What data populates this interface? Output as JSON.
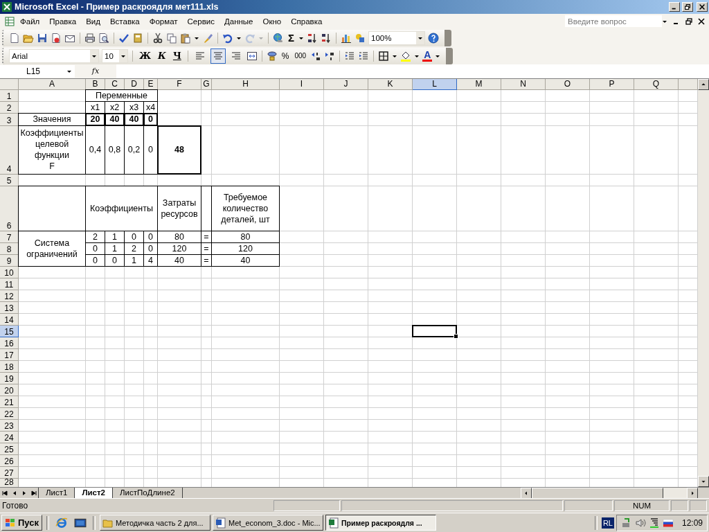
{
  "window": {
    "title": "Microsoft Excel - Пример раскроядля мет111.xls"
  },
  "menu": [
    {
      "label": "Файл"
    },
    {
      "label": "Правка"
    },
    {
      "label": "Вид"
    },
    {
      "label": "Вставка"
    },
    {
      "label": "Формат"
    },
    {
      "label": "Сервис"
    },
    {
      "label": "Данные"
    },
    {
      "label": "Окно"
    },
    {
      "label": "Справка"
    }
  ],
  "help_search": {
    "placeholder": "Введите вопрос"
  },
  "standard_toolbar": {
    "redo_disabled": true,
    "autosum": "Σ",
    "zoom": "100%"
  },
  "formatting_toolbar": {
    "font": "Arial",
    "size": "10",
    "style_buttons": [
      "Ж",
      "К",
      "Ч"
    ],
    "align_buttons": [
      {
        "selected": false
      },
      {
        "selected": true
      },
      {
        "selected": false
      }
    ],
    "percent": "%",
    "thousands": "000",
    "font_color": "A"
  },
  "formula_bar": {
    "name_box": "L15",
    "function_label": "fx"
  },
  "sheet": {
    "columns": [
      {
        "label": "A",
        "selected": false
      },
      {
        "label": "B",
        "selected": false
      },
      {
        "label": "C",
        "selected": false
      },
      {
        "label": "D",
        "selected": false
      },
      {
        "label": "E",
        "selected": false
      },
      {
        "label": "F",
        "selected": false
      },
      {
        "label": "G",
        "selected": false
      },
      {
        "label": "H",
        "selected": false
      },
      {
        "label": "I",
        "selected": false
      },
      {
        "label": "J",
        "selected": false
      },
      {
        "label": "K",
        "selected": false
      },
      {
        "label": "L",
        "selected": true
      },
      {
        "label": "M",
        "selected": false
      },
      {
        "label": "N",
        "selected": false
      },
      {
        "label": "O",
        "selected": false
      },
      {
        "label": "P",
        "selected": false
      },
      {
        "label": "Q",
        "selected": false
      }
    ],
    "rows": [
      {
        "label": "1",
        "selected": false
      },
      {
        "label": "2",
        "selected": false
      },
      {
        "label": "3",
        "selected": false
      },
      {
        "label": "4",
        "selected": false
      },
      {
        "label": "5",
        "selected": false
      },
      {
        "label": "6",
        "selected": false
      },
      {
        "label": "7",
        "selected": false
      },
      {
        "label": "8",
        "selected": false
      },
      {
        "label": "9",
        "selected": false
      },
      {
        "label": "10",
        "selected": false
      },
      {
        "label": "11",
        "selected": false
      },
      {
        "label": "12",
        "selected": false
      },
      {
        "label": "13",
        "selected": false
      },
      {
        "label": "14",
        "selected": false
      },
      {
        "label": "15",
        "selected": true
      },
      {
        "label": "16",
        "selected": false
      },
      {
        "label": "17",
        "selected": false
      },
      {
        "label": "18",
        "selected": false
      },
      {
        "label": "19",
        "selected": false
      },
      {
        "label": "20",
        "selected": false
      },
      {
        "label": "21",
        "selected": false
      },
      {
        "label": "22",
        "selected": false
      },
      {
        "label": "23",
        "selected": false
      },
      {
        "label": "24",
        "selected": false
      },
      {
        "label": "25",
        "selected": false
      },
      {
        "label": "26",
        "selected": false
      },
      {
        "label": "27",
        "selected": false
      },
      {
        "label": "28",
        "selected": false
      }
    ],
    "cells": [
      {
        "text": "Переменные",
        "bold": false
      },
      {
        "text": "x1",
        "bold": false
      },
      {
        "text": "x2",
        "bold": false
      },
      {
        "text": "x3",
        "bold": false
      },
      {
        "text": "x4",
        "bold": false
      },
      {
        "text": "Значения",
        "bold": false
      },
      {
        "text": "20",
        "bold": true
      },
      {
        "text": "40",
        "bold": true
      },
      {
        "text": "40",
        "bold": true
      },
      {
        "text": "0",
        "bold": true
      },
      {
        "text": "Коэффициенты\nцелевой\nфункции\nF",
        "bold": false
      },
      {
        "text": "0,4",
        "bold": false
      },
      {
        "text": "0,8",
        "bold": false
      },
      {
        "text": "0,2",
        "bold": false
      },
      {
        "text": "0",
        "bold": false
      },
      {
        "text": "48",
        "bold": true
      },
      {
        "text": "Коэффициенты",
        "bold": false
      },
      {
        "text": "Затраты\nресурсов",
        "bold": false
      },
      {
        "text": "Требуемое\nколичество\nдеталей, шт",
        "bold": false
      },
      {
        "text": "Система\nограничений",
        "bold": false
      },
      {
        "text": "2",
        "bold": false
      },
      {
        "text": "1",
        "bold": false
      },
      {
        "text": "0",
        "bold": false
      },
      {
        "text": "0",
        "bold": false
      },
      {
        "text": "80",
        "bold": false
      },
      {
        "text": "=",
        "bold": false
      },
      {
        "text": "80",
        "bold": false
      },
      {
        "text": "0",
        "bold": false
      },
      {
        "text": "1",
        "bold": false
      },
      {
        "text": "2",
        "bold": false
      },
      {
        "text": "0",
        "bold": false
      },
      {
        "text": "120",
        "bold": false
      },
      {
        "text": "=",
        "bold": false
      },
      {
        "text": "120",
        "bold": false
      },
      {
        "text": "0",
        "bold": false
      },
      {
        "text": "0",
        "bold": false
      },
      {
        "text": "1",
        "bold": false
      },
      {
        "text": "4",
        "bold": false
      },
      {
        "text": "40",
        "bold": false
      },
      {
        "text": "=",
        "bold": false
      },
      {
        "text": "40",
        "bold": false
      }
    ]
  },
  "sheet_tabs": [
    {
      "label": "Лист1",
      "selected": false
    },
    {
      "label": "Лист2",
      "selected": true
    },
    {
      "label": "ЛистПоДлине2",
      "selected": false
    }
  ],
  "status_bar": {
    "message": "Готово",
    "indicator": "NUM"
  },
  "taskbar": {
    "start": "Пуск",
    "tasks": [
      {
        "label": "Методичка часть 2 для...",
        "kind": "folder",
        "selected": false
      },
      {
        "label": "Met_econom_3.doc - Mic...",
        "kind": "word",
        "selected": false
      },
      {
        "label": "Пример раскроядля ...",
        "kind": "excel",
        "selected": true
      }
    ],
    "language": "RL",
    "clock": "12:09"
  }
}
